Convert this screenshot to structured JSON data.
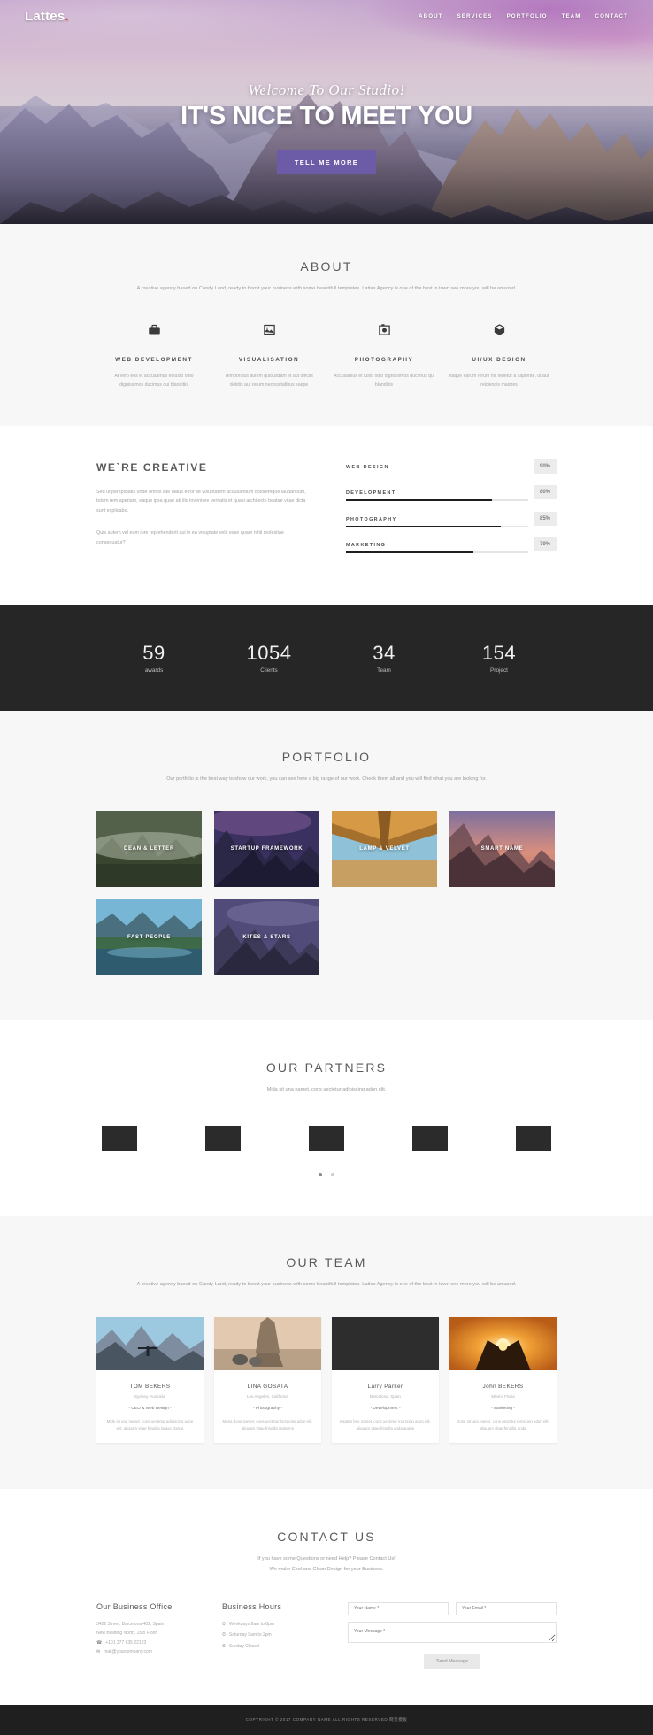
{
  "nav": {
    "brand": "Lattes",
    "brand_dot": ".",
    "links": [
      {
        "label": "ABOUT"
      },
      {
        "label": "SERVICES"
      },
      {
        "label": "PORTFOLIO"
      },
      {
        "label": "TEAM"
      },
      {
        "label": "CONTACT"
      }
    ]
  },
  "hero": {
    "subtitle": "Welcome To Our Studio!",
    "title": "IT'S NICE TO MEET YOU",
    "button": "TELL ME MORE",
    "button_color": "#6c5ca8"
  },
  "about": {
    "title": "ABOUT",
    "description": "A creative agency based on Candy Land, ready to boost your business with some beautifull templates. Lattes Agency is one of the best in town see more you will be amazed.",
    "services": [
      {
        "icon": "briefcase-icon",
        "glyph": "💼",
        "title": "WEB DEVELOPMENT",
        "desc": "At vero eos et accusamus et iusto odio dignissimos ducimus qui blanditiis"
      },
      {
        "icon": "image-icon",
        "glyph": "🖼",
        "title": "VISUALISATION",
        "desc": "Temporibus autem quibusdam et aut officiis debitis aut rerum necessitatibus saepe"
      },
      {
        "icon": "camera-icon",
        "glyph": "📷",
        "title": "PHOTOGRAPHY",
        "desc": "Accusamus et iusto odio dignissimos ducimus qui blanditiis"
      },
      {
        "icon": "cube-icon",
        "glyph": "⬡",
        "title": "UI/UX DESIGN",
        "desc": "Itaque earum rerum hic tenetur a sapiente, ut aut reiciendis maiores"
      }
    ]
  },
  "creative": {
    "heading": "WE`RE CREATIVE",
    "paragraphs": [
      "Sed ut perspiciatis unde omnis iste natus error sit voluptatem accusantium doloremque laudantium, totam rem aperiam, eaque ipsa quae ab illo inventore veritatis et quasi architecto beatae vitae dicta sunt explicabo.",
      "Quis autem vel eum iure reprehenderit qui in ea voluptate velit esse quam nihil molestiae consequatur?"
    ],
    "skills": [
      {
        "name": "WEB DESIGN",
        "value": 90,
        "label": "90%"
      },
      {
        "name": "DEVELOPMENT",
        "value": 80,
        "label": "80%"
      },
      {
        "name": "PHOTOGRAPHY",
        "value": 85,
        "label": "85%"
      },
      {
        "name": "MARKETING",
        "value": 70,
        "label": "70%"
      }
    ]
  },
  "counters": [
    {
      "number": "59",
      "label": "awards"
    },
    {
      "number": "1054",
      "label": "Clients"
    },
    {
      "number": "34",
      "label": "Team"
    },
    {
      "number": "154",
      "label": "Project"
    }
  ],
  "portfolio": {
    "title": "PORTFOLIO",
    "description": "Our portfolio is the best way to show our work, you can see here a big range of our work. Check them all and you will find what you are looking for.",
    "items": [
      {
        "label": "DEAN & LETTER"
      },
      {
        "label": "STARTUP FRAMEWORK"
      },
      {
        "label": "LAMP & VELVET"
      },
      {
        "label": "SMART NAME"
      },
      {
        "label": "FAST PEOPLE"
      },
      {
        "label": "KITES & STARS"
      }
    ]
  },
  "partners": {
    "title": "OUR PARTNERS",
    "description": "Mida sit una namet, cons uectetur adipiscing adon elit.",
    "logos": [
      {
        "name": "partner-1"
      },
      {
        "name": "partner-2"
      },
      {
        "name": "partner-3"
      },
      {
        "name": "partner-4"
      },
      {
        "name": "partner-5"
      }
    ]
  },
  "team": {
    "title": "OUR TEAM",
    "description": "A creative agency based on Candy Land, ready to boost your business with some beautifull templates. Lattes Agency is one of the best in town see more you will be amazed.",
    "members": [
      {
        "name": "TOM BEKERS",
        "location": "Sydney, Australia",
        "role": "- CEO & Web Design -",
        "desc": "Mide sit una namet, cons uectetur adipiscing adon elit, aliquam vitae fringilla lorase donna"
      },
      {
        "name": "LINA GOSATA",
        "location": "Los Angeles, California",
        "role": "- Photography -",
        "desc": "Mona dona namet, cons uectetur lorspcing adon elit, aliquam vitae fringilla unda mn"
      },
      {
        "name": "Larry Parker",
        "location": "Barcelona, Spain",
        "role": "- Development -",
        "desc": "Kaatan bne namet, cons uectetur morscing adon elit, aliquam vitae fringilla unda augue"
      },
      {
        "name": "John BEKERS",
        "location": "Miami, Floria",
        "role": "- Marketing -",
        "desc": "Dolor sit una namet, cons uectetur temscing adon elit, aliquam vitae fringilla unda"
      }
    ]
  },
  "contact": {
    "title": "CONTACT US",
    "description_line1": "If you have some Questions or need Help? Please Contact Us!",
    "description_line2": "We make Cool and Clean Design for your Business.",
    "office": {
      "heading": "Our Business Office",
      "address_line1": "3422 Street, Barcelona 402, Spain",
      "address_line2": "New Building North, 15th Floor",
      "phone_icon": "phone-icon",
      "phone": "+101 377 635 22123",
      "mail_icon": "mail-icon",
      "email": "mail@yourcompany.com"
    },
    "hours": {
      "heading": "Business Hours",
      "items": [
        {
          "icon": "clock-icon",
          "text": "Weekdays 9am to 8pm"
        },
        {
          "icon": "clock-icon",
          "text": "Saturday 9am to 2pm"
        },
        {
          "icon": "clock-icon",
          "text": "Sunday Closed"
        }
      ]
    },
    "form": {
      "name_placeholder": "Your Name *",
      "email_placeholder": "Your Email *",
      "message_placeholder": "Your Message *",
      "submit_label": "Send Message"
    }
  },
  "footer": {
    "text": "COPYRIGHT © 2017 COMPANY NAME ALL RIGHTS RESERVED 网页模板"
  }
}
